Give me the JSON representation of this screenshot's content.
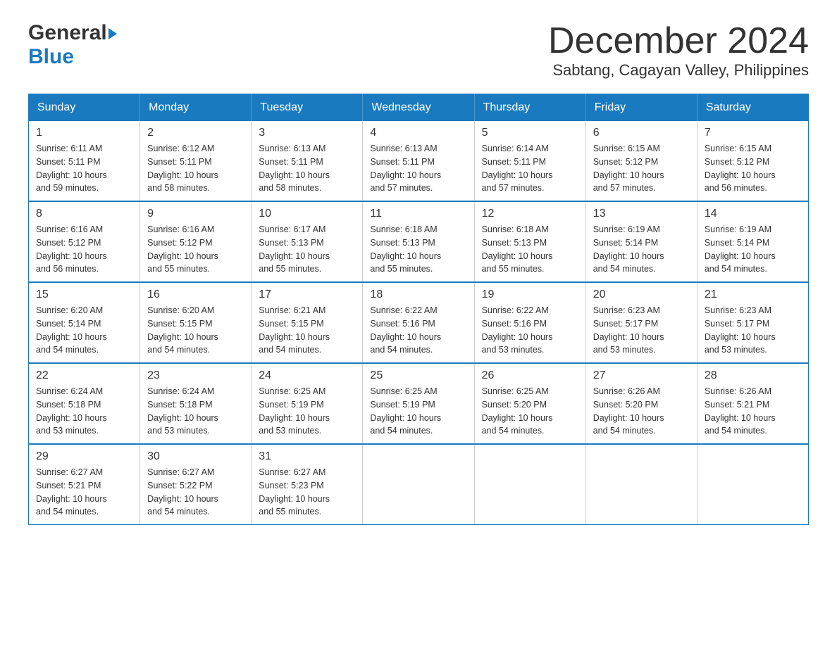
{
  "header": {
    "logo_general": "General",
    "logo_blue": "Blue",
    "title": "December 2024",
    "subtitle": "Sabtang, Cagayan Valley, Philippines"
  },
  "calendar": {
    "days_of_week": [
      "Sunday",
      "Monday",
      "Tuesday",
      "Wednesday",
      "Thursday",
      "Friday",
      "Saturday"
    ],
    "weeks": [
      [
        {
          "day": "1",
          "sunrise": "6:11 AM",
          "sunset": "5:11 PM",
          "daylight": "10 hours and 59 minutes."
        },
        {
          "day": "2",
          "sunrise": "6:12 AM",
          "sunset": "5:11 PM",
          "daylight": "10 hours and 58 minutes."
        },
        {
          "day": "3",
          "sunrise": "6:13 AM",
          "sunset": "5:11 PM",
          "daylight": "10 hours and 58 minutes."
        },
        {
          "day": "4",
          "sunrise": "6:13 AM",
          "sunset": "5:11 PM",
          "daylight": "10 hours and 57 minutes."
        },
        {
          "day": "5",
          "sunrise": "6:14 AM",
          "sunset": "5:11 PM",
          "daylight": "10 hours and 57 minutes."
        },
        {
          "day": "6",
          "sunrise": "6:15 AM",
          "sunset": "5:12 PM",
          "daylight": "10 hours and 57 minutes."
        },
        {
          "day": "7",
          "sunrise": "6:15 AM",
          "sunset": "5:12 PM",
          "daylight": "10 hours and 56 minutes."
        }
      ],
      [
        {
          "day": "8",
          "sunrise": "6:16 AM",
          "sunset": "5:12 PM",
          "daylight": "10 hours and 56 minutes."
        },
        {
          "day": "9",
          "sunrise": "6:16 AM",
          "sunset": "5:12 PM",
          "daylight": "10 hours and 55 minutes."
        },
        {
          "day": "10",
          "sunrise": "6:17 AM",
          "sunset": "5:13 PM",
          "daylight": "10 hours and 55 minutes."
        },
        {
          "day": "11",
          "sunrise": "6:18 AM",
          "sunset": "5:13 PM",
          "daylight": "10 hours and 55 minutes."
        },
        {
          "day": "12",
          "sunrise": "6:18 AM",
          "sunset": "5:13 PM",
          "daylight": "10 hours and 55 minutes."
        },
        {
          "day": "13",
          "sunrise": "6:19 AM",
          "sunset": "5:14 PM",
          "daylight": "10 hours and 54 minutes."
        },
        {
          "day": "14",
          "sunrise": "6:19 AM",
          "sunset": "5:14 PM",
          "daylight": "10 hours and 54 minutes."
        }
      ],
      [
        {
          "day": "15",
          "sunrise": "6:20 AM",
          "sunset": "5:14 PM",
          "daylight": "10 hours and 54 minutes."
        },
        {
          "day": "16",
          "sunrise": "6:20 AM",
          "sunset": "5:15 PM",
          "daylight": "10 hours and 54 minutes."
        },
        {
          "day": "17",
          "sunrise": "6:21 AM",
          "sunset": "5:15 PM",
          "daylight": "10 hours and 54 minutes."
        },
        {
          "day": "18",
          "sunrise": "6:22 AM",
          "sunset": "5:16 PM",
          "daylight": "10 hours and 54 minutes."
        },
        {
          "day": "19",
          "sunrise": "6:22 AM",
          "sunset": "5:16 PM",
          "daylight": "10 hours and 53 minutes."
        },
        {
          "day": "20",
          "sunrise": "6:23 AM",
          "sunset": "5:17 PM",
          "daylight": "10 hours and 53 minutes."
        },
        {
          "day": "21",
          "sunrise": "6:23 AM",
          "sunset": "5:17 PM",
          "daylight": "10 hours and 53 minutes."
        }
      ],
      [
        {
          "day": "22",
          "sunrise": "6:24 AM",
          "sunset": "5:18 PM",
          "daylight": "10 hours and 53 minutes."
        },
        {
          "day": "23",
          "sunrise": "6:24 AM",
          "sunset": "5:18 PM",
          "daylight": "10 hours and 53 minutes."
        },
        {
          "day": "24",
          "sunrise": "6:25 AM",
          "sunset": "5:19 PM",
          "daylight": "10 hours and 53 minutes."
        },
        {
          "day": "25",
          "sunrise": "6:25 AM",
          "sunset": "5:19 PM",
          "daylight": "10 hours and 54 minutes."
        },
        {
          "day": "26",
          "sunrise": "6:25 AM",
          "sunset": "5:20 PM",
          "daylight": "10 hours and 54 minutes."
        },
        {
          "day": "27",
          "sunrise": "6:26 AM",
          "sunset": "5:20 PM",
          "daylight": "10 hours and 54 minutes."
        },
        {
          "day": "28",
          "sunrise": "6:26 AM",
          "sunset": "5:21 PM",
          "daylight": "10 hours and 54 minutes."
        }
      ],
      [
        {
          "day": "29",
          "sunrise": "6:27 AM",
          "sunset": "5:21 PM",
          "daylight": "10 hours and 54 minutes."
        },
        {
          "day": "30",
          "sunrise": "6:27 AM",
          "sunset": "5:22 PM",
          "daylight": "10 hours and 54 minutes."
        },
        {
          "day": "31",
          "sunrise": "6:27 AM",
          "sunset": "5:23 PM",
          "daylight": "10 hours and 55 minutes."
        },
        null,
        null,
        null,
        null
      ]
    ],
    "labels": {
      "sunrise": "Sunrise:",
      "sunset": "Sunset:",
      "daylight": "Daylight:"
    }
  }
}
